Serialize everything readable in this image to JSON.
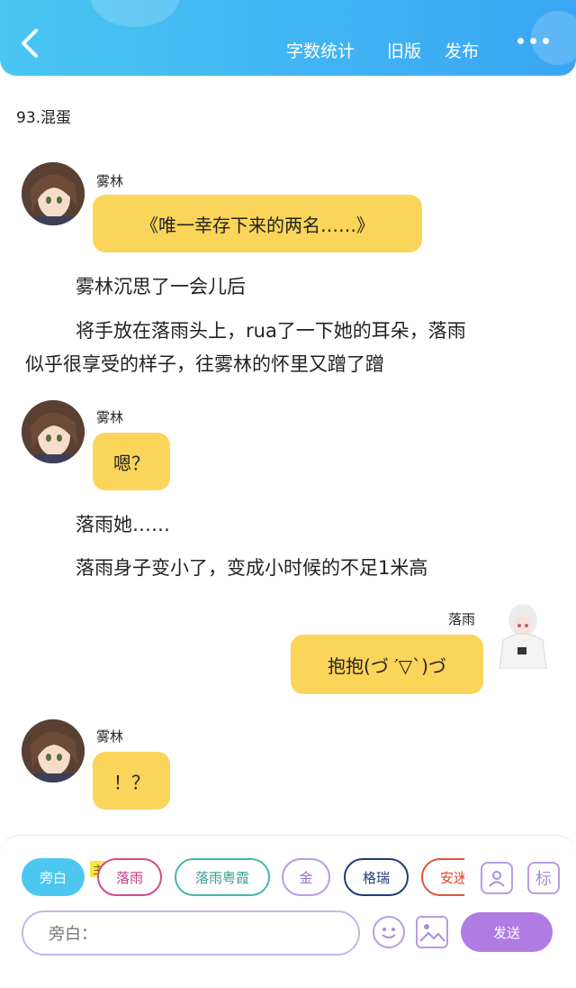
{
  "header": {
    "word_count": "字数统计",
    "old_version": "旧版",
    "publish": "发布"
  },
  "chapter_title": "93.混蛋",
  "messages": [
    {
      "speaker": "雾林",
      "text": "《唯一幸存下来的两名……》"
    },
    {
      "speaker": "雾林",
      "text": "嗯？"
    },
    {
      "speaker": "落雨",
      "text": "抱抱(づ ′▽`)づ"
    },
    {
      "speaker": "雾林",
      "text": "！？"
    }
  ],
  "narration": [
    "雾林沉思了一会儿后",
    "将手放在落雨头上，rua了一下她的耳朵，落雨",
    "似乎很享受的样子，往雾林的怀里又蹭了蹭",
    "落雨她……",
    "落雨身子变小了，变成小时候的不足1米高"
  ],
  "composer": {
    "chips": [
      "旁白",
      "落雨",
      "落雨粤霞",
      "金",
      "格瑞",
      "安迷"
    ],
    "main_tag": "主",
    "user_icon": "user-icon",
    "tag_icon_label": "标",
    "input_placeholder": "旁白：",
    "send_label": "发送"
  },
  "colors": {
    "header": "#3aa6f4",
    "bubble": "#fbd45a",
    "send": "#b07be3",
    "chip_active": "#4cc7f0"
  }
}
